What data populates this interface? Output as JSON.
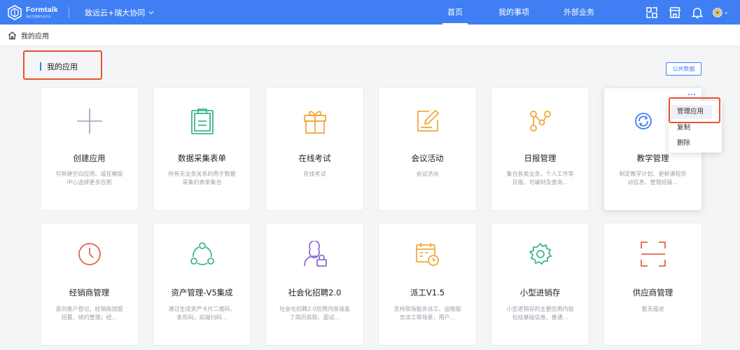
{
  "app": {
    "brand": "Formtalk",
    "brand_sub": "致远互联数字化平台",
    "org_name": "致远云+瑞大协同"
  },
  "nav": {
    "items": [
      {
        "label": "首页",
        "active": true
      },
      {
        "label": "我的事项",
        "active": false
      },
      {
        "label": "外部业务",
        "active": false
      }
    ]
  },
  "icons": {
    "topbar": [
      "apps-icon",
      "store-icon",
      "bell-icon",
      "avatar"
    ],
    "breadcrumb": "home-icon"
  },
  "breadcrumb": {
    "label": "我的应用"
  },
  "section": {
    "title": "我的应用",
    "public_data_button": "公共数据"
  },
  "cards": [
    {
      "title": "创建应用",
      "desc": "可新建空白应用、或在模版中心选择更多应用",
      "icon": "plus-icon",
      "color": "#9aa5b1"
    },
    {
      "title": "数据采集表单",
      "desc": "所有无业务关系的用于数据采集的表单集合",
      "icon": "clipboard-icon",
      "color": "#3cb88a"
    },
    {
      "title": "在线考试",
      "desc": "在线考试",
      "icon": "gift-icon",
      "color": "#f2a93b"
    },
    {
      "title": "会议活动",
      "desc": "会议活动",
      "icon": "edit-icon",
      "color": "#f2a93b"
    },
    {
      "title": "日报管理",
      "desc": "集合各类业务，个人工作等日报，可编制及查询...",
      "icon": "workflow-icon",
      "color": "#f2a93b"
    },
    {
      "title": "教学管理",
      "desc": "制定教学计划、更新课程异动信息，管理班级...",
      "icon": "refresh-icon",
      "color": "#3f7ef3"
    },
    {
      "title": "经销商管理",
      "desc": "意向客户登记、经销商加盟招募、续约管理；经...",
      "icon": "clock-icon",
      "color": "#e5634d"
    },
    {
      "title": "资产管理-V5集成",
      "desc": "通过生成资产卡片二维码、条形码，前端扫码...",
      "icon": "share-icon",
      "color": "#3cb88a"
    },
    {
      "title": "社会化招聘2.0",
      "desc": "社会化招聘2.0应用内容涵盖了简历获取、面试...",
      "icon": "user-lock-icon",
      "color": "#8a6cd8"
    },
    {
      "title": "派工V1.5",
      "desc": "支持现场服务派工、运维服务派工等场景，用户...",
      "icon": "calendar-clock-icon",
      "color": "#f2a93b"
    },
    {
      "title": "小型进销存",
      "desc": "小型进销存的主要应用内容包括基础信息、普通...",
      "icon": "gear-icon",
      "color": "#3cb88a"
    },
    {
      "title": "供应商管理",
      "desc": "暂无描述",
      "icon": "scan-frame-icon",
      "color": "#e5634d"
    }
  ],
  "context_menu": {
    "items": [
      {
        "label": "管理应用",
        "highlighted": true
      },
      {
        "label": "复制",
        "highlighted": false
      },
      {
        "label": "删除",
        "highlighted": false
      }
    ]
  },
  "colors": {
    "primary": "#3f7ef3",
    "highlight_box": "#e8532d"
  }
}
